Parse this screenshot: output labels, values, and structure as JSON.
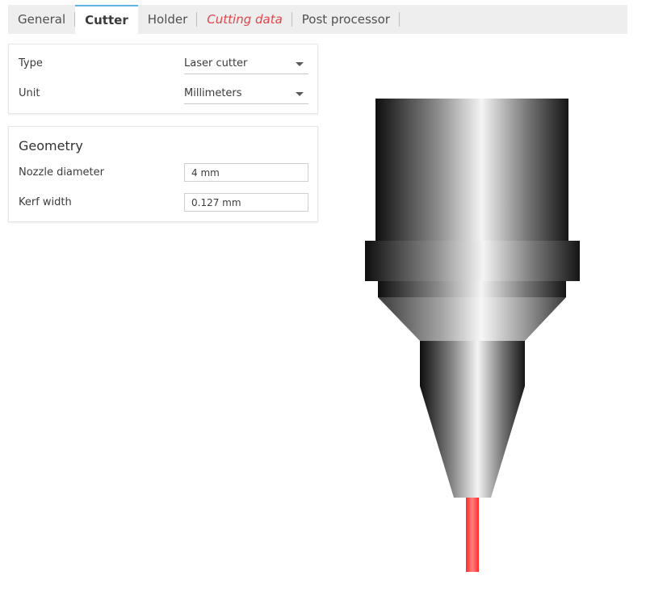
{
  "tabs": [
    {
      "label": "General",
      "active": false,
      "warning": false
    },
    {
      "label": "Cutter",
      "active": true,
      "warning": false
    },
    {
      "label": "Holder",
      "active": false,
      "warning": false
    },
    {
      "label": "Cutting data",
      "active": false,
      "warning": true
    },
    {
      "label": "Post processor",
      "active": false,
      "warning": false
    }
  ],
  "settings": {
    "type_label": "Type",
    "type_value": "Laser cutter",
    "unit_label": "Unit",
    "unit_value": "Millimeters"
  },
  "geometry": {
    "title": "Geometry",
    "nozzle_label": "Nozzle diameter",
    "nozzle_value": "4 mm",
    "kerf_label": "Kerf width",
    "kerf_value": "0.127 mm"
  },
  "colors": {
    "tab_active_border": "#5fb3e3",
    "warning_text": "#e0454b",
    "laser_beam": "#ff4d4d"
  },
  "icons": {
    "dropdown": "caret-down-icon",
    "preview": "laser-nozzle-illustration"
  }
}
